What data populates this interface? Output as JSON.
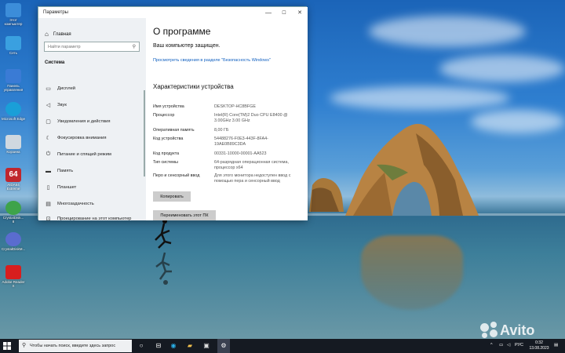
{
  "window": {
    "title": "Параметры",
    "minimize": "—",
    "maximize": "☐",
    "close": "✕"
  },
  "sidebar": {
    "home": "Главная",
    "search_placeholder": "Найти параметр",
    "section": "Система",
    "items": [
      {
        "label": "Дисплей",
        "icon": "display-icon"
      },
      {
        "label": "Звук",
        "icon": "sound-icon"
      },
      {
        "label": "Уведомления и действия",
        "icon": "notifications-icon"
      },
      {
        "label": "Фокусировка внимания",
        "icon": "focus-icon"
      },
      {
        "label": "Питание и спящий режим",
        "icon": "power-icon"
      },
      {
        "label": "Память",
        "icon": "storage-icon"
      },
      {
        "label": "Планшет",
        "icon": "tablet-icon"
      },
      {
        "label": "Многозадачность",
        "icon": "multitasking-icon"
      },
      {
        "label": "Проецирование на этот компьютер",
        "icon": "projecting-icon"
      }
    ]
  },
  "content": {
    "title": "О программе",
    "protected": "Ваш компьютер защищен.",
    "security_link": "Просмотреть сведения в разделе \"Безопасность Windows\"",
    "specs_title": "Характеристики устройства",
    "specs": [
      {
        "key": "Имя устройства",
        "value": "DESKTOP-HC8BFGE"
      },
      {
        "key": "Процессор",
        "value": "Intel(R) Core(TM)2 Duo CPU     E8400  @ 3.00GHz   3.00 GHz"
      },
      {
        "key": "Оперативная память",
        "value": "8,00 ГБ"
      },
      {
        "key": "Код устройства",
        "value": "54488276-F0E3-443F-8FA4-19AE0B89C3DA"
      },
      {
        "key": "Код продукта",
        "value": "00331-10000-00001-AA523"
      },
      {
        "key": "Тип системы",
        "value": "64-разрядная операционная система, процессор x64"
      },
      {
        "key": "Перо и сенсорный ввод",
        "value": "Для этого монитора недоступен ввод с помощью пера и сенсорный ввод"
      }
    ],
    "copy_button": "Копировать",
    "rename_button": "Переименовать этот ПК"
  },
  "desktop_icons": [
    {
      "label": "Этот компьютер",
      "color": "#3c8dd9"
    },
    {
      "label": "Сеть",
      "color": "#3aa0e0"
    },
    {
      "label": "Панель управления",
      "color": "#3a7bd5"
    },
    {
      "label": "Microsoft Edge",
      "color": "#1a9fd8"
    },
    {
      "label": "Корзина",
      "color": "#cfd8e0"
    },
    {
      "label": "AIDA64 Extreme",
      "color": "#c0262d"
    },
    {
      "label": "CrystalDisk... 8",
      "color": "#3ea34a"
    },
    {
      "label": "CrystalDiskM...",
      "color": "#5a6ccf"
    },
    {
      "label": "Adobe Reader X",
      "color": "#d81e1e"
    }
  ],
  "taskbar": {
    "search_placeholder": "Чтобы начать поиск, введите здесь запрос",
    "language": "РУС",
    "time": "0:32",
    "date": "13.08.2023"
  },
  "watermark": "Avito"
}
